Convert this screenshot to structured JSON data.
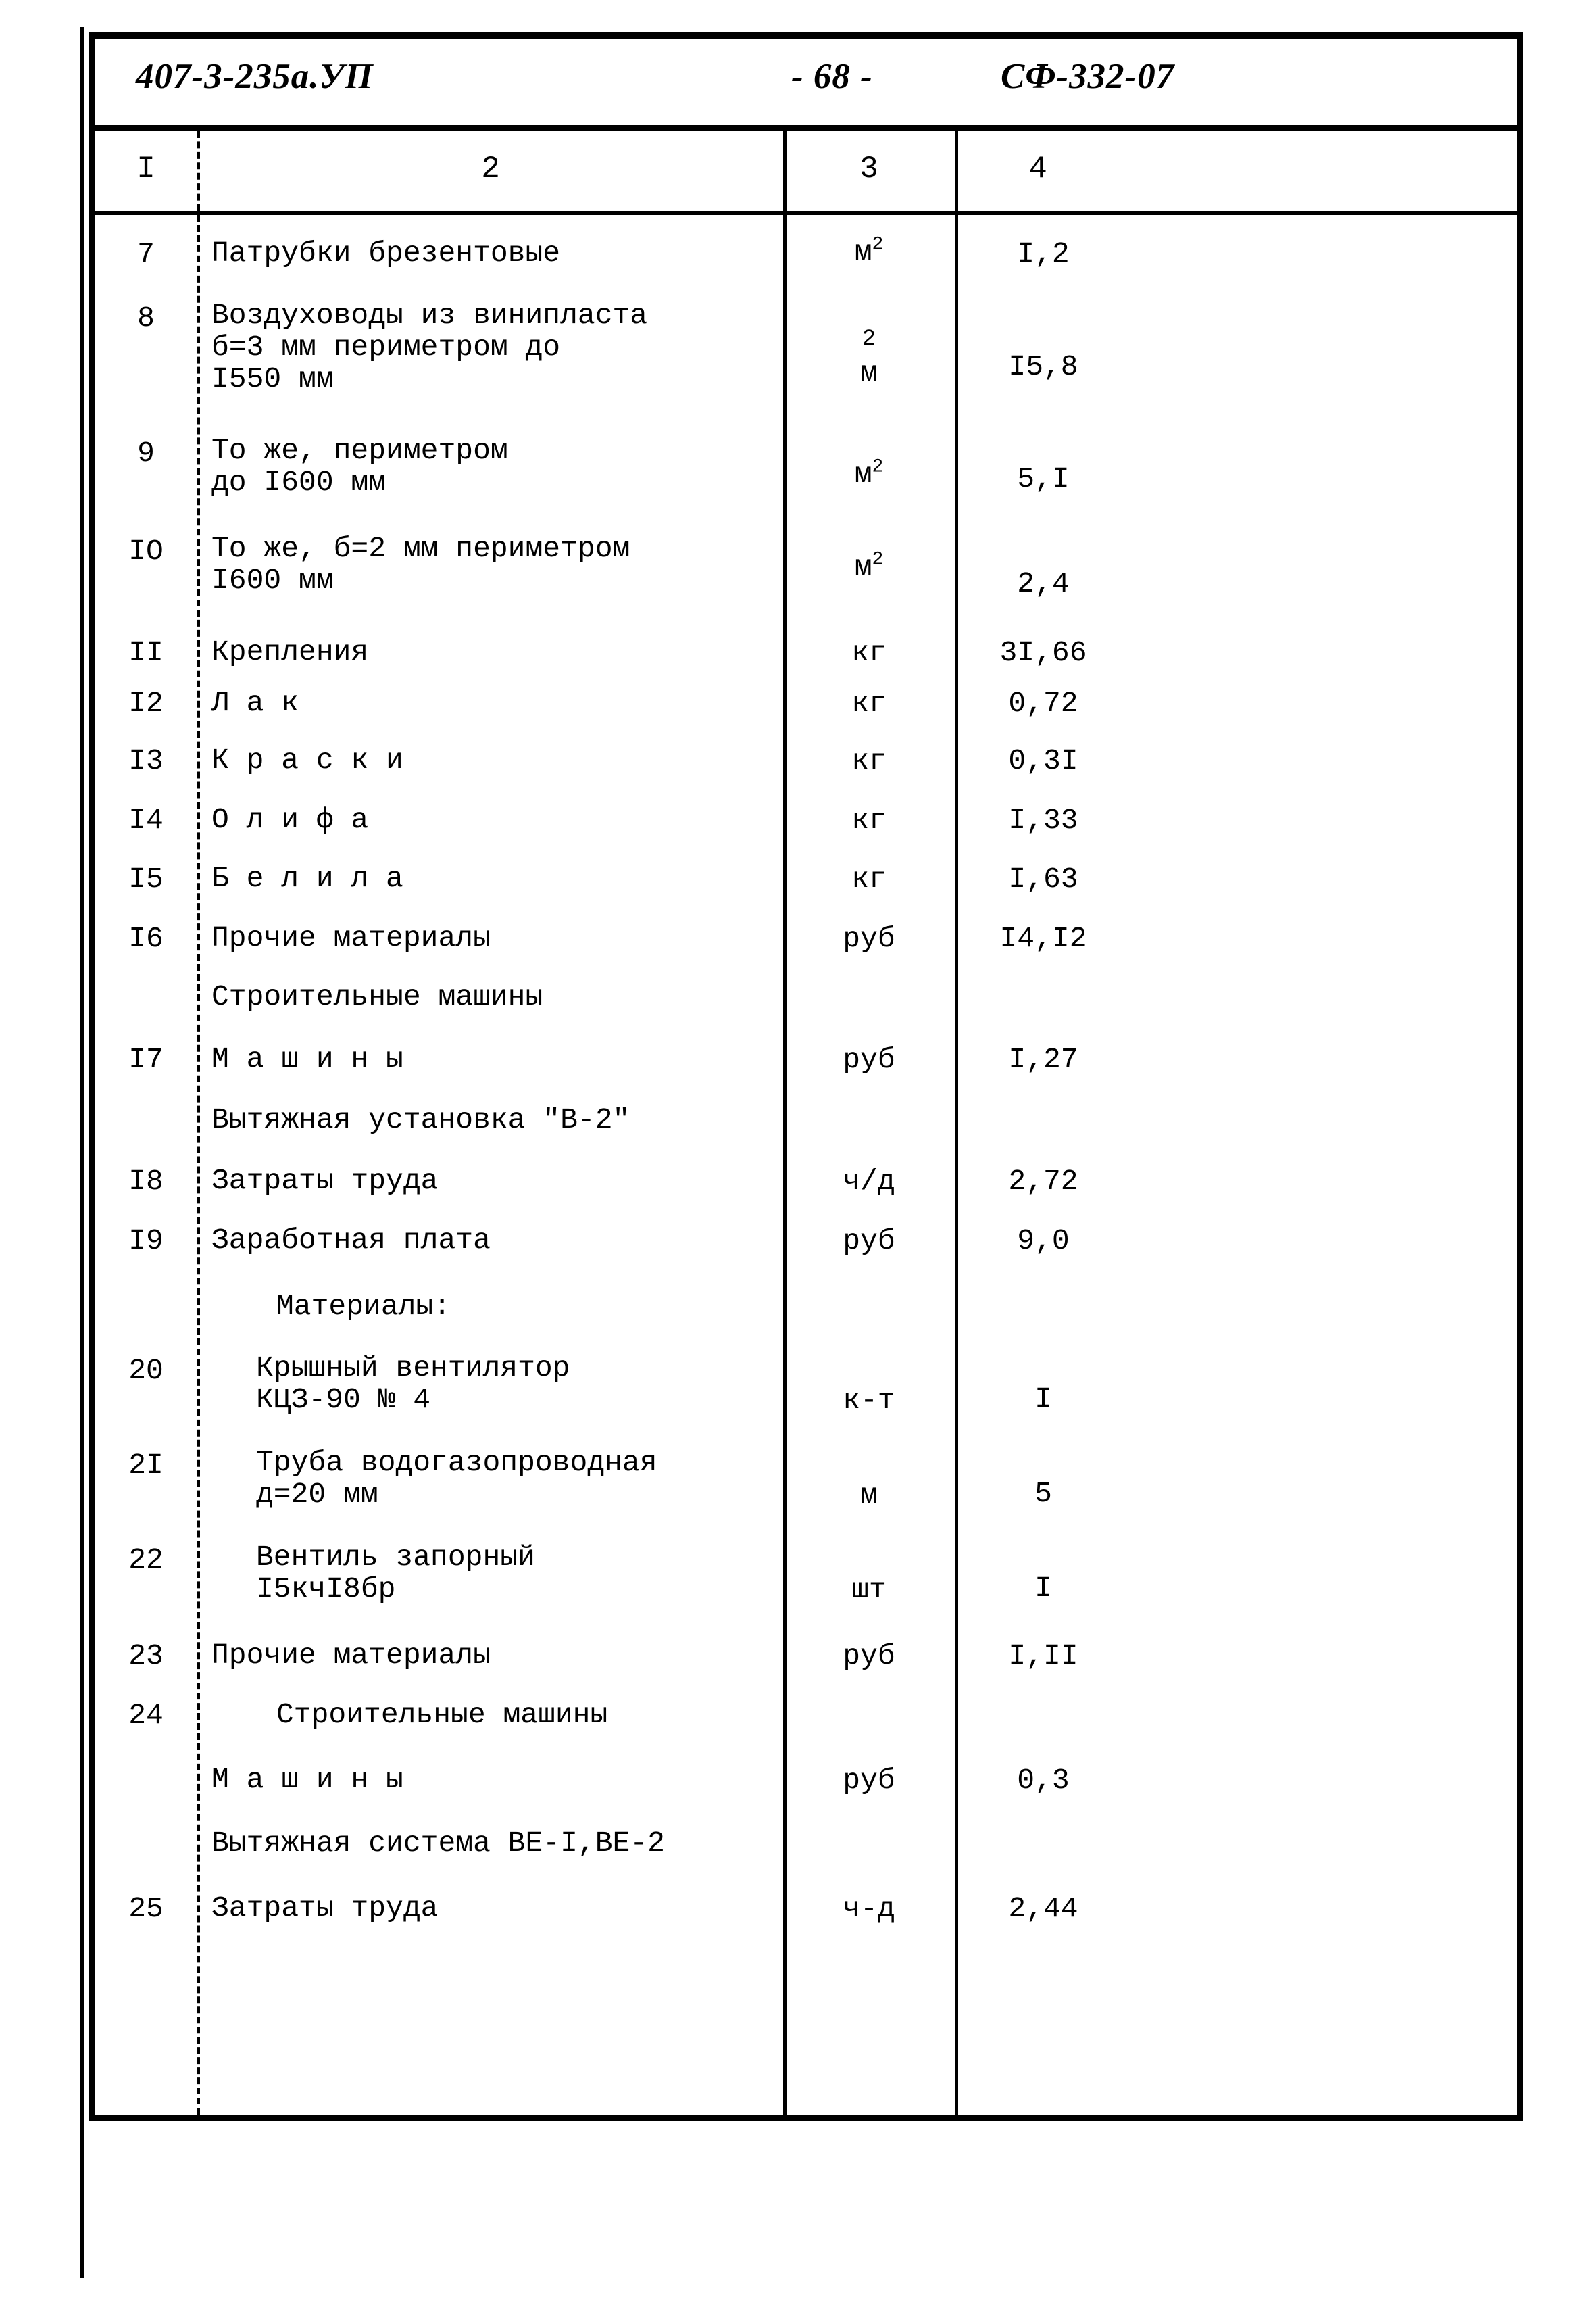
{
  "header": {
    "document_code": "407-3-235а.УП",
    "page_number": "- 68 -",
    "sheet_code": "СФ-332-07"
  },
  "table": {
    "column_numbers": [
      "I",
      "2",
      "3",
      "4"
    ],
    "rows": [
      {
        "num": "7",
        "desc": "Патрубки брезентовые",
        "unit": "м",
        "unit_exp": "2",
        "qty": "I,2"
      },
      {
        "num": "8",
        "desc": "Воздуховоды из винипласта\nб=3 мм периметром до\nI550 мм",
        "unit": "м",
        "unit_exp": "2",
        "qty": "I5,8"
      },
      {
        "num": "9",
        "desc": "То же, периметром\nдо I600 мм",
        "unit": "м",
        "unit_exp": "2",
        "qty": "5,I"
      },
      {
        "num": "IO",
        "desc": "То же, б=2 мм периметром\nI600 мм",
        "unit": "м",
        "unit_exp": "2",
        "qty": "2,4"
      },
      {
        "num": "II",
        "desc": "Крепления",
        "unit": "кг",
        "unit_exp": "",
        "qty": "3I,66"
      },
      {
        "num": "I2",
        "desc": "Л а к",
        "unit": "кг",
        "unit_exp": "",
        "qty": "0,72"
      },
      {
        "num": "I3",
        "desc": "К р а с к и",
        "unit": "кг",
        "unit_exp": "",
        "qty": "0,3I"
      },
      {
        "num": "I4",
        "desc": "О л и ф а",
        "unit": "кг",
        "unit_exp": "",
        "qty": "I,33"
      },
      {
        "num": "I5",
        "desc": "Б е л и л а",
        "unit": "кг",
        "unit_exp": "",
        "qty": "I,63"
      },
      {
        "num": "I6",
        "desc": "Прочие материалы",
        "unit": "руб",
        "unit_exp": "",
        "qty": "I4,I2"
      },
      {
        "num": "",
        "desc": "Строительные машины",
        "unit": "",
        "unit_exp": "",
        "qty": ""
      },
      {
        "num": "I7",
        "desc": "М а ш и н ы",
        "unit": "руб",
        "unit_exp": "",
        "qty": "I,27"
      },
      {
        "num": "",
        "desc": "Вытяжная установка \"В-2\"",
        "unit": "",
        "unit_exp": "",
        "qty": ""
      },
      {
        "num": "I8",
        "desc": "Затраты труда",
        "unit": "ч/д",
        "unit_exp": "",
        "qty": "2,72"
      },
      {
        "num": "I9",
        "desc": "Заработная плата",
        "unit": "руб",
        "unit_exp": "",
        "qty": "9,0"
      },
      {
        "num": "",
        "desc": "Материалы:",
        "unit": "",
        "unit_exp": "",
        "qty": ""
      },
      {
        "num": "20",
        "desc": "Крышный вентилятор\nКЦЗ-90 № 4",
        "unit": "к-т",
        "unit_exp": "",
        "qty": "I"
      },
      {
        "num": "2I",
        "desc": "Труба водогазопроводная\nд=20 мм",
        "unit": "м",
        "unit_exp": "",
        "qty": "5"
      },
      {
        "num": "22",
        "desc": "Вентиль запорный\nI5кчI8бр",
        "unit": "шт",
        "unit_exp": "",
        "qty": "I"
      },
      {
        "num": "23",
        "desc": "Прочие материалы",
        "unit": "руб",
        "unit_exp": "",
        "qty": "I,II"
      },
      {
        "num": "24",
        "desc": "Строительные машины",
        "unit": "",
        "unit_exp": "",
        "qty": ""
      },
      {
        "num": "",
        "desc": "М а ш и н ы",
        "unit": "руб",
        "unit_exp": "",
        "qty": "0,3"
      },
      {
        "num": "",
        "desc": "Вытяжная система ВЕ-I,ВЕ-2",
        "unit": "",
        "unit_exp": "",
        "qty": ""
      },
      {
        "num": "25",
        "desc": "Затраты труда",
        "unit": "ч-д",
        "unit_exp": "",
        "qty": "2,44"
      }
    ]
  }
}
